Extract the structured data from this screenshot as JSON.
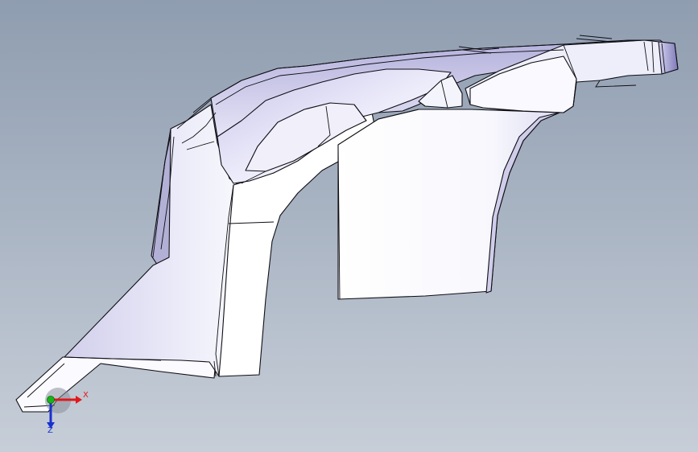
{
  "view": {
    "background_top": "#8f9db0",
    "background_bottom": "#c7ced8",
    "edge_color": "#0e0e14",
    "face_light": "#f6f6fc",
    "face_shade": "#c9c6e6"
  },
  "triad": {
    "x_label": "X",
    "z_label": "Z",
    "x_color": "#e01818",
    "y_color": "#18b418",
    "z_color": "#1830d0"
  }
}
